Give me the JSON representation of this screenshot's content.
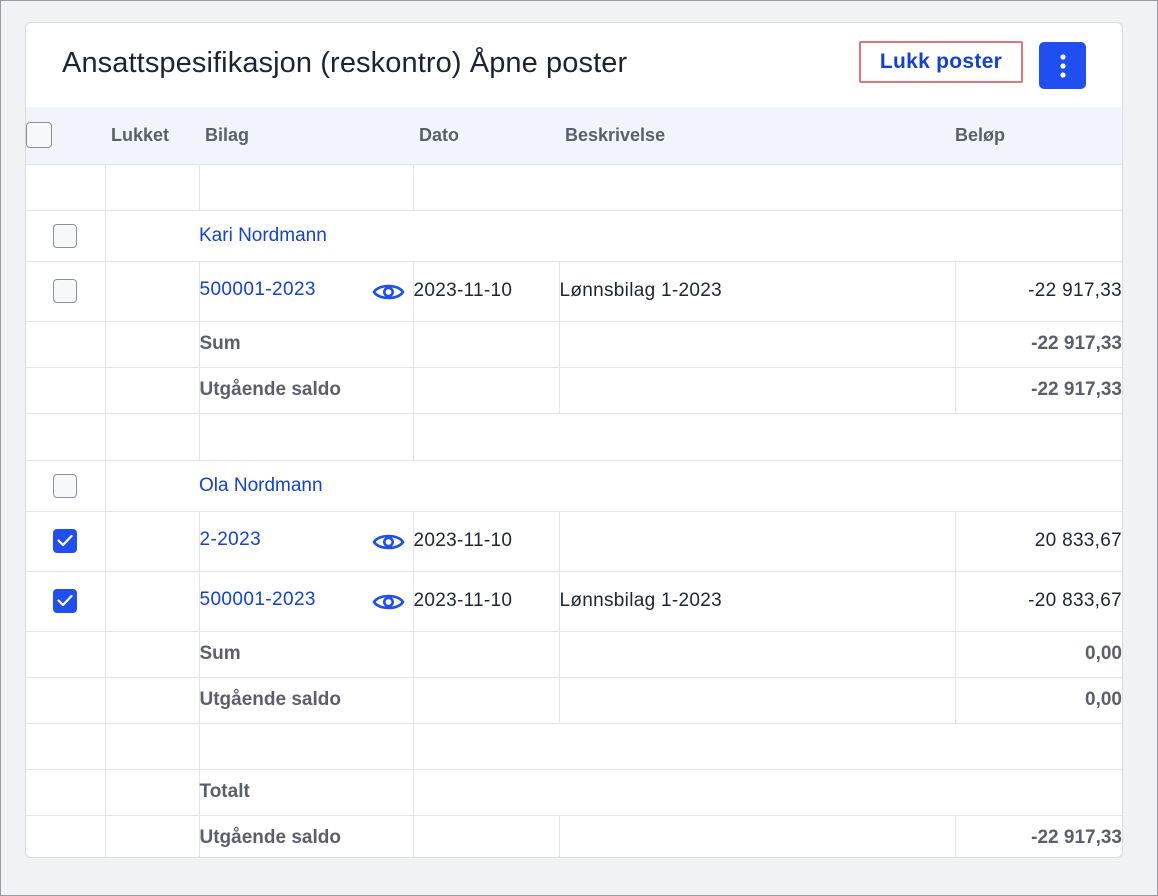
{
  "title": "Ansattspesifikasjon (reskontro) Åpne poster",
  "actions": {
    "close_entries": "Lukk poster"
  },
  "columns": {
    "closed": "Lukket",
    "voucher": "Bilag",
    "date": "Dato",
    "description": "Beskrivelse",
    "amount": "Beløp"
  },
  "groups": [
    {
      "name": "Kari Nordmann",
      "checked": false,
      "entries": [
        {
          "voucher": "500001-2023",
          "date": "2023-11-10",
          "description": "Lønnsbilag 1-2023",
          "amount": "-22 917,33",
          "checked": false
        }
      ],
      "sum_label": "Sum",
      "sum": "-22 917,33",
      "balance_label": "Utgående saldo",
      "balance": "-22 917,33"
    },
    {
      "name": "Ola Nordmann",
      "checked": false,
      "entries": [
        {
          "voucher": "2-2023",
          "date": "2023-11-10",
          "description": "",
          "amount": "20 833,67",
          "checked": true
        },
        {
          "voucher": "500001-2023",
          "date": "2023-11-10",
          "description": "Lønnsbilag 1-2023",
          "amount": "-20 833,67",
          "checked": true
        }
      ],
      "sum_label": "Sum",
      "sum": "0,00",
      "balance_label": "Utgående saldo",
      "balance": "0,00"
    }
  ],
  "totals": {
    "label": "Totalt",
    "balance_label": "Utgående saldo",
    "balance": "-22 917,33"
  },
  "colors": {
    "accent": "#1f4ff0",
    "link": "#1141d8",
    "highlight_border": "#e0737f"
  },
  "icons": {
    "menu": "kebab-vertical-icon",
    "view": "eye-icon",
    "check": "checkmark-icon"
  }
}
